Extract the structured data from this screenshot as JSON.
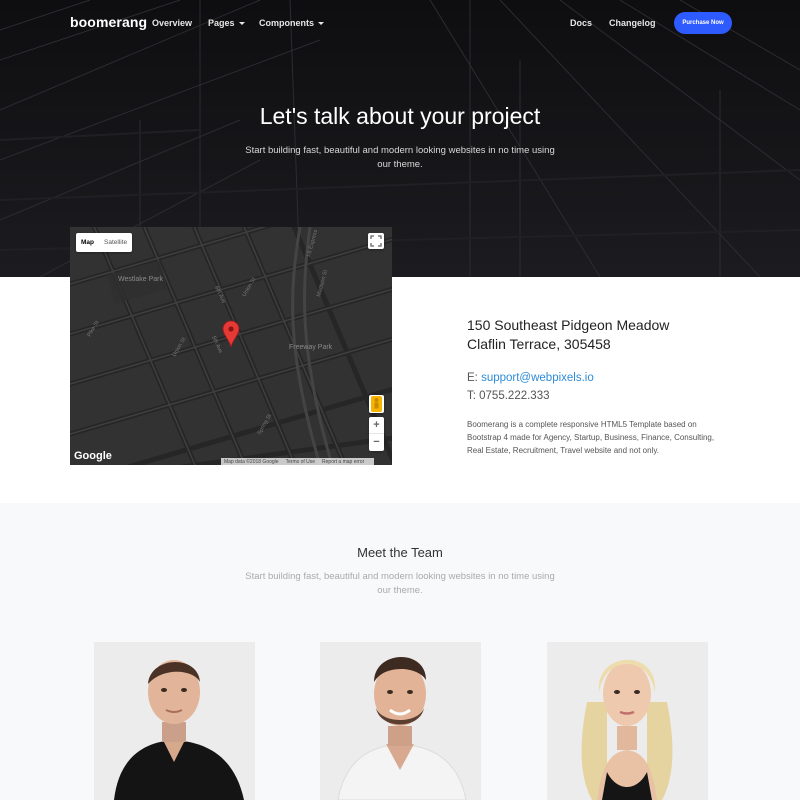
{
  "nav": {
    "brand": "boomerang",
    "items": [
      {
        "label": "Overview",
        "dropdown": false
      },
      {
        "label": "Pages",
        "dropdown": true
      },
      {
        "label": "Components",
        "dropdown": true
      }
    ],
    "right_items": [
      {
        "label": "Docs"
      },
      {
        "label": "Changelog"
      }
    ],
    "purchase_label": "Purchase Now",
    "accent_color": "#2e5bff"
  },
  "hero": {
    "title": "Let's talk about your project",
    "subtitle": "Start building fast, beautiful and modern looking websites in no time using our theme."
  },
  "map": {
    "type_options": [
      "Map",
      "Satellite"
    ],
    "selected_type": "Map",
    "labels": {
      "westlake": "Westlake Park",
      "freeway": "Freeway Park",
      "pike_st": "Pike St",
      "union_st": "Union St",
      "spring_st": "Spring St",
      "sixth_ave": "6th Ave",
      "fifth_ave": "5th Ave",
      "i5": "I-5 Express",
      "madison": "Madison St"
    },
    "zoom_in": "+",
    "zoom_out": "−",
    "logo": "Google",
    "attribution": [
      "Map data ©2018 Google",
      "Terms of Use",
      "Report a map error"
    ],
    "icons": [
      "fullscreen-icon",
      "pegman-icon",
      "map-marker-icon"
    ]
  },
  "contact": {
    "address_line1": "150 Southeast Pidgeon Meadow",
    "address_line2": "Claflin Terrace, 305458",
    "email_prefix": "E: ",
    "email": "support@webpixels.io",
    "phone_prefix": "T: ",
    "phone": "0755.222.333",
    "description": "Boomerang is a complete responsive HTML5 Template based on Bootstrap 4 made for Agency, Startup, Business, Finance, Consulting, Real Estate, Recruitment, Travel website and not only."
  },
  "team": {
    "title": "Meet the Team",
    "subtitle": "Start building fast, beautiful and modern looking websites in no time using our theme.",
    "members": 3
  }
}
